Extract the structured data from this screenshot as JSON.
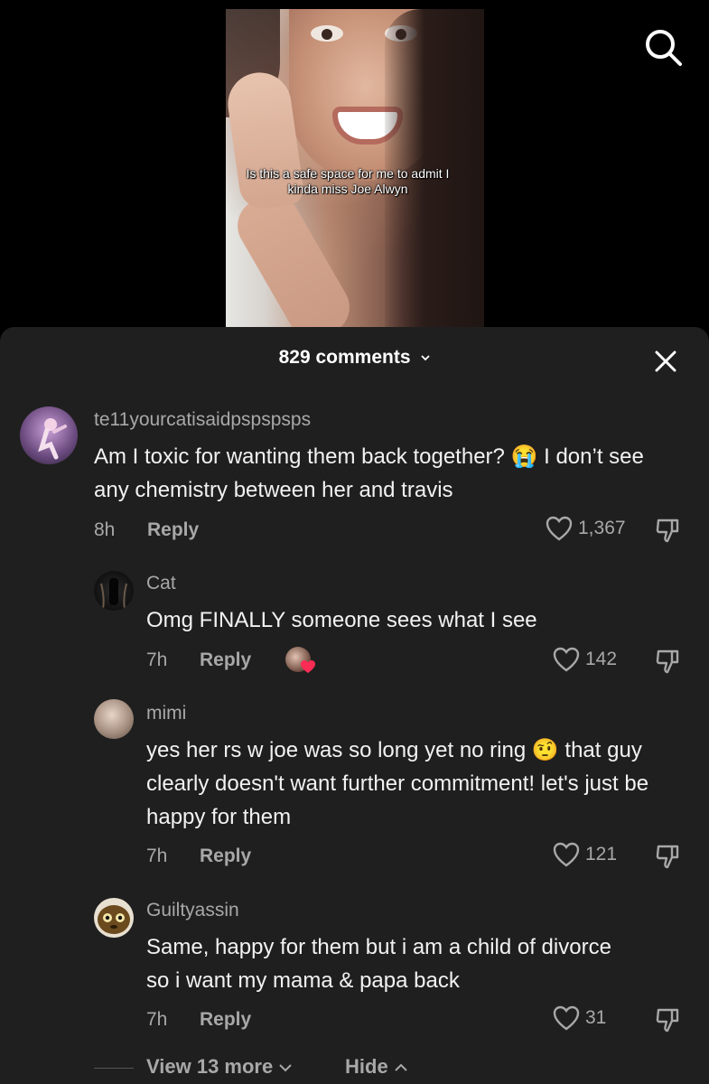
{
  "video": {
    "caption": "Is this a safe space for me to admit I kinda miss Joe Alwyn"
  },
  "comments_header": {
    "count_label": "829 comments"
  },
  "comments": [
    {
      "username": "te11yourcatisaidpspspsps",
      "text": "Am I toxic for wanting them back together? 😭 I don’t see any chemistry between her and travis",
      "time": "8h",
      "reply_label": "Reply",
      "likes": "1,367"
    },
    {
      "username": "Cat",
      "text": "Omg FINALLY someone sees what I see",
      "time": "7h",
      "reply_label": "Reply",
      "likes": "142"
    },
    {
      "username": "mimi",
      "text": "yes her rs w joe was so long yet no ring 🤨 that guy clearly doesn't want further commitment! let's just be happy for them",
      "time": "7h",
      "reply_label": "Reply",
      "likes": "121"
    },
    {
      "username": "Guiltyassin",
      "text": "Same, happy for them but i am a child of divorce so i want my mama & papa back",
      "time": "7h",
      "reply_label": "Reply",
      "likes": "31"
    }
  ],
  "footer": {
    "view_more_label": "View 13 more",
    "hide_label": "Hide"
  },
  "colors": {
    "sheet_bg": "#1f1f1f",
    "muted_text": "#a8a8a8"
  }
}
